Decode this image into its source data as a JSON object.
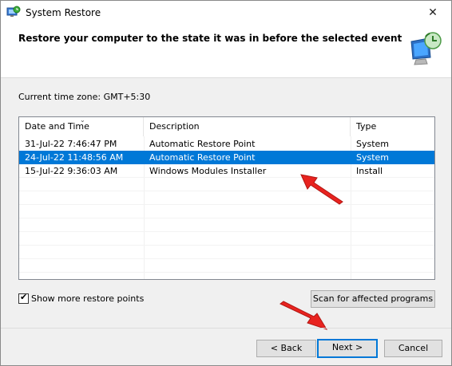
{
  "window": {
    "title": "System Restore",
    "close_glyph": "✕",
    "heading": "Restore your computer to the state it was in before the selected event"
  },
  "timezone": {
    "text": "Current time zone: GMT+5:30"
  },
  "table": {
    "columns": [
      "Date and Time",
      "Description",
      "Type"
    ],
    "rows": [
      {
        "date": "31-Jul-22 7:46:47 PM",
        "description": "Automatic Restore Point",
        "type": "System",
        "selected": false
      },
      {
        "date": "24-Jul-22 11:48:56 AM",
        "description": "Automatic Restore Point",
        "type": "System",
        "selected": true
      },
      {
        "date": "15-Jul-22 9:36:03 AM",
        "description": "Windows Modules Installer",
        "type": "Install",
        "selected": false
      }
    ]
  },
  "options": {
    "show_more_label": "Show more restore points",
    "show_more_checked": true
  },
  "buttons": {
    "scan": "Scan for affected programs",
    "back": "< Back",
    "next": "Next >",
    "cancel": "Cancel"
  },
  "colors": {
    "selection": "#0078d7",
    "annotation_arrow": "#e8231f"
  },
  "icons": [
    "system-restore-icon",
    "close-icon",
    "restore-monitor-icon",
    "sort-arrow-icon",
    "checkmark-icon",
    "annotation-arrow-icon"
  ]
}
